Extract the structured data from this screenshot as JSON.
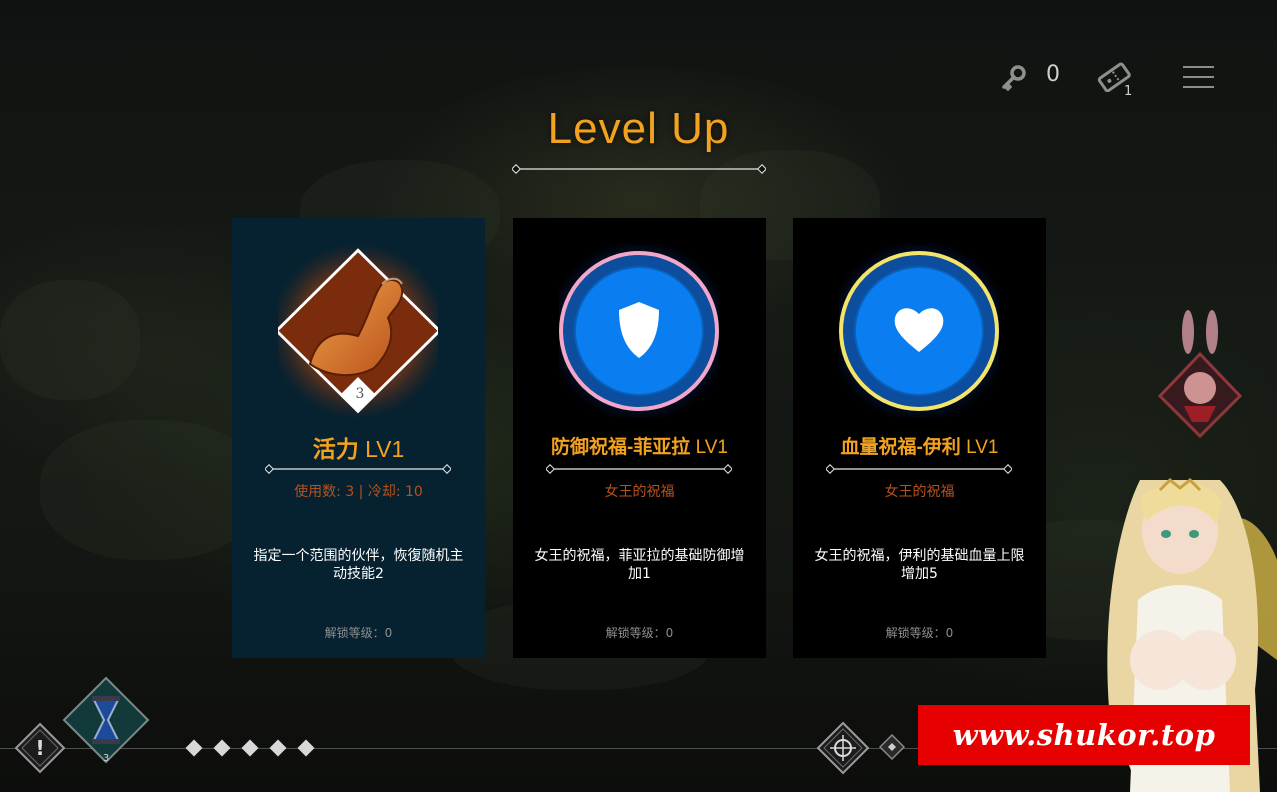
{
  "screen_title": "Level Up",
  "hud": {
    "key_count": "0",
    "ticket_count": "1"
  },
  "cards": [
    {
      "name": "活力",
      "level": "LV1",
      "subtitle": "使用数: 3 | 冷却: 10",
      "description": "指定一个范围的伙伴，恢復随机主动技能2",
      "unlock": "解锁等级：0",
      "badge": "3",
      "icon": "flexed-arm-icon",
      "selected": true
    },
    {
      "name": "防御祝福-菲亚拉",
      "level": "LV1",
      "subtitle": "女王的祝福",
      "description": "女王的祝福，菲亚拉的基础防御增加1",
      "unlock": "解锁等级：0",
      "icon": "shield-icon",
      "ring_color": "#f2a7c8"
    },
    {
      "name": "血量祝福-伊利",
      "level": "LV1",
      "subtitle": "女王的祝福",
      "description": "女王的祝福，伊利的基础血量上限增加5",
      "unlock": "解锁等级：0",
      "icon": "heart-icon",
      "ring_color": "#f2e56a"
    }
  ],
  "bottom_bar": {
    "hourglass_badge": "3",
    "stage_dot_count": 5
  },
  "watermark": "www.shukor.top",
  "colors": {
    "accent_orange": "#f3a21f",
    "subtitle_orange": "#b6521f",
    "selected_card_bg": "#062231",
    "orb_blue": "#0a7ef0"
  }
}
